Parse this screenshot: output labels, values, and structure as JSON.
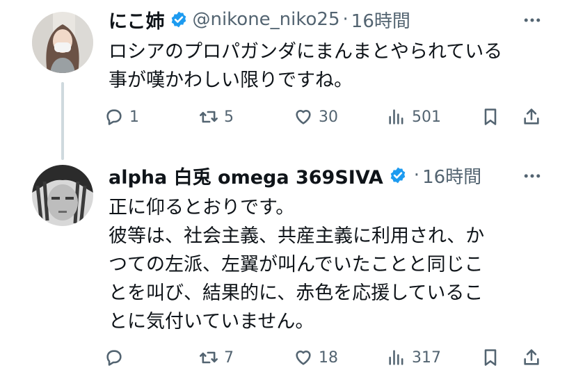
{
  "tweets": [
    {
      "display_name": "にこ姉",
      "handle": "@nikone_niko25",
      "separator": "·",
      "time": "16時間",
      "lines": [
        "ロシアのプロパガンダにまんまとやられている",
        "事が嘆かわしい限りですね。"
      ],
      "stats": {
        "replies": "1",
        "reposts": "5",
        "likes": "30",
        "views": "501"
      },
      "avatar_icon": "woman-portrait-avatar"
    },
    {
      "display_name": "alpha 白兎 omega 369SIVA",
      "handle": "",
      "separator": "·",
      "time": "16時間",
      "lines": [
        "正に仰るとおりです。",
        "彼等は、社会主義、共産主義に利用され、か",
        "つての左派、左翼が叫んでいたことと同じこ",
        "とを叫び、結果的に、赤色を応援しているこ",
        "とに気付いていません。"
      ],
      "stats": {
        "replies": "",
        "reposts": "7",
        "likes": "18",
        "views": "317"
      },
      "avatar_icon": "grayscale-face-avatar"
    }
  ],
  "colors": {
    "verified": "#1d9bf0",
    "muted": "#536471",
    "text": "#0f1419",
    "thread_line": "#cfd9de"
  },
  "icons": [
    "verified-badge-icon",
    "more-icon",
    "reply-icon",
    "repost-icon",
    "like-icon",
    "views-icon",
    "bookmark-icon",
    "share-icon"
  ]
}
